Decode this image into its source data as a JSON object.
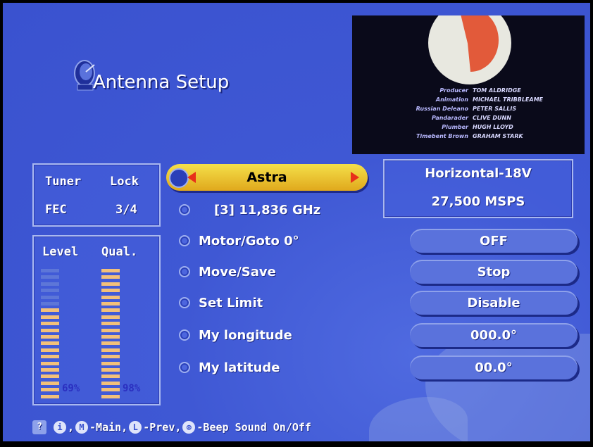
{
  "title": "Antenna Setup",
  "preview": {
    "credits": [
      {
        "role": "Producer",
        "name": "TOM ALDRIDGE"
      },
      {
        "role": "Animation",
        "name": "MICHAEL TRIBBLEAME"
      },
      {
        "role": "Russian Deleano",
        "name": "PETER SALLIS"
      },
      {
        "role": "Pandarader",
        "name": "CLIVE DUNN"
      },
      {
        "role": "Plumber",
        "name": "HUGH LLOYD"
      },
      {
        "role": "Timebent Brown",
        "name": "GRAHAM STARK"
      }
    ]
  },
  "tuner": {
    "tuner_label": "Tuner",
    "lock_label": "Lock",
    "fec_label": "FEC",
    "fec_value": "3/4"
  },
  "signal": {
    "level_label": "Level",
    "quality_label": "Qual.",
    "level_percent": 69,
    "quality_percent": 98,
    "level_text": "69%",
    "quality_text": "98%",
    "segments_total": 20
  },
  "satellite": {
    "name": "Astra",
    "transponder": "[3] 11,836 GHz"
  },
  "transponder_info": {
    "polarization": "Horizontal-18V",
    "symbol_rate": "27,500 MSPS"
  },
  "menu": [
    {
      "label": "Motor/Goto 0°",
      "value": "OFF"
    },
    {
      "label": "Move/Save",
      "value": "Stop"
    },
    {
      "label": "Set Limit",
      "value": "Disable"
    },
    {
      "label": "My longitude",
      "value": "000.0°"
    },
    {
      "label": "My latitude",
      "value": "00.0°"
    }
  ],
  "help": {
    "help_key": "?",
    "info_key": "i",
    "main_key": "M",
    "main_text": "-Main,",
    "prev_key": "L",
    "prev_text": "-Prev,",
    "beep_key": "⊗",
    "beep_text": "-Beep Sound On/Off"
  },
  "colors": {
    "background": "#3f58d4",
    "level_bar": "#f2c07a",
    "level_bar_empty": "#5d76d8",
    "selector": "#f0c83a",
    "arrow": "#e8301a",
    "percent_text": "#2a2fc0"
  }
}
